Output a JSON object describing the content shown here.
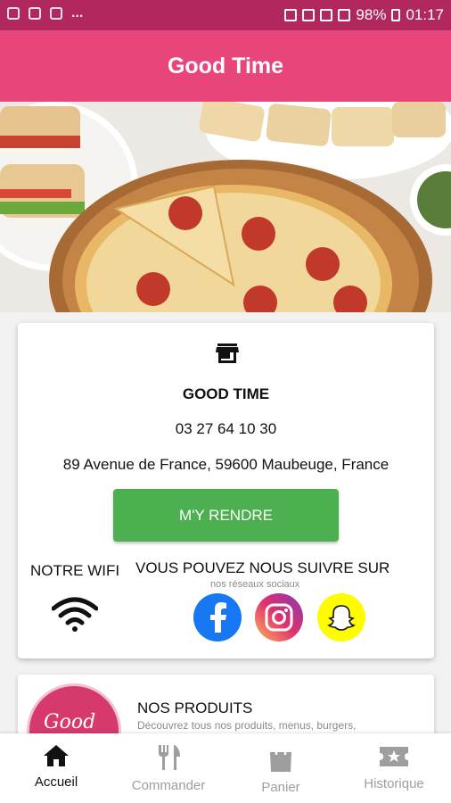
{
  "status_bar": {
    "battery": "98%",
    "time": "01:17",
    "dots": "..."
  },
  "app": {
    "title": "Good Time",
    "accent": "#e8457a",
    "status_color": "#b0285e"
  },
  "info_card": {
    "name": "GOOD TIME",
    "phone": "03 27 64 10 30",
    "address": "89 Avenue de France, 59600 Maubeuge, France",
    "directions_button": "M'Y RENDRE",
    "button_color": "#4caf50",
    "wifi_label": "NOTRE WIFI",
    "social_title": "VOUS POUVEZ NOUS SUIVRE SUR",
    "social_subtitle": "nos réseaux sociaux",
    "icons": [
      "store-icon",
      "wifi-icon",
      "facebook-icon",
      "instagram-icon",
      "snapchat-icon"
    ]
  },
  "products_card": {
    "logo_text": "Good",
    "title": "NOS PRODUITS",
    "description": "Découvrez tous nos produits, menus, burgers,"
  },
  "bottom_nav": [
    {
      "label": "Accueil",
      "icon": "home-icon",
      "active": true
    },
    {
      "label": "Commander",
      "icon": "utensils-icon",
      "active": false
    },
    {
      "label": "Panier",
      "icon": "shopping-bag-icon",
      "active": false
    },
    {
      "label": "Historique",
      "icon": "ticket-star-icon",
      "active": false
    }
  ]
}
